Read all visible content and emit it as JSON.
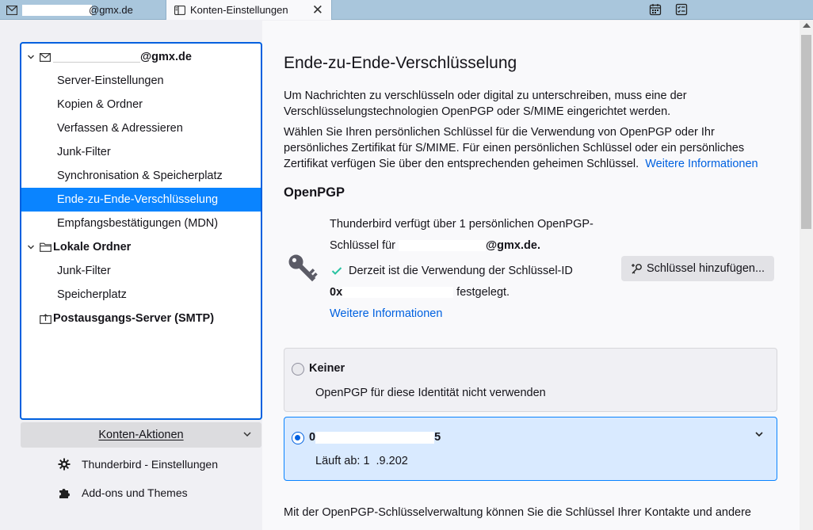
{
  "tabs": [
    {
      "label": "@gmx.de",
      "redacted_prefix": true
    },
    {
      "label": "Konten-Einstellungen",
      "close": "✕"
    }
  ],
  "tree": {
    "account": {
      "label": "@gmx.de"
    },
    "account_items": [
      "Server-Einstellungen",
      "Kopien & Ordner",
      "Verfassen & Adressieren",
      "Junk-Filter",
      "Synchronisation & Speicherplatz",
      "Ende-zu-Ende-Verschlüsselung",
      "Empfangsbestätigungen (MDN)"
    ],
    "local": {
      "label": "Lokale Ordner"
    },
    "local_items": [
      "Junk-Filter",
      "Speicherplatz"
    ],
    "smtp": {
      "label": "Postausgangs-Server (SMTP)"
    }
  },
  "account_actions": {
    "label": "Konten-Aktionen"
  },
  "footer": {
    "settings": "Thunderbird - Einstellungen",
    "addons": "Add-ons und Themes"
  },
  "main": {
    "title": "Ende-zu-Ende-Verschlüsselung",
    "intro_1a": "Um Nachrichten zu verschlüsseln oder digital zu unterschreiben, muss eine der",
    "intro_1b": "Verschlüsselungstechnologien OpenPGP oder S/MIME eingerichtet werden.",
    "intro_2a": "Wählen Sie Ihren persönlichen Schlüssel für die Verwendung von OpenPGP oder Ihr",
    "intro_2b": "persönliches Zertifikat für S/MIME. Für einen persönlichen Schlüssel oder ein persönliches",
    "intro_2c": "Zertifikat verfügen Sie über den entsprechenden geheimen Schlüssel.",
    "more_info": "Weitere Informationen",
    "openpgp_heading": "OpenPGP",
    "pgp_line1": "Thunderbird verfügt über 1 persönlichen OpenPGP-",
    "pgp_line2_prefix": "Schlüssel für",
    "pgp_line2_suffix": "@gmx.de.",
    "pgp_status": "Derzeit ist die Verwendung der Schlüssel-ID",
    "pgp_keyid_prefix": "0x",
    "pgp_keyid_suffix": "festgelegt.",
    "pgp_more_info": "Weitere Informationen",
    "add_key_button": "Schlüssel hinzufügen...",
    "option_none_title": "Keiner",
    "option_none_desc": "OpenPGP für diese Identität nicht verwenden",
    "option_key_prefix": "0",
    "option_key_suffix": "5",
    "option_key_expires": "Läuft ab: 1",
    "option_key_expires_suffix": ".9.202",
    "bottom_text": "Mit der OpenPGP-Schlüsselverwaltung können Sie die Schlüssel Ihrer Kontakte und andere"
  },
  "colors": {
    "accent": "#0a84ff",
    "link": "#0061e0",
    "check": "#2ac3a2"
  },
  "icons": [
    "mail-icon",
    "settings-tab-icon",
    "close-icon",
    "calendar-icon",
    "tasks-icon",
    "twisty-icon",
    "folder-icon",
    "outbox-icon",
    "chevron-down-icon",
    "gear-icon",
    "puzzle-icon",
    "key-icon",
    "check-icon",
    "add-key-icon"
  ]
}
